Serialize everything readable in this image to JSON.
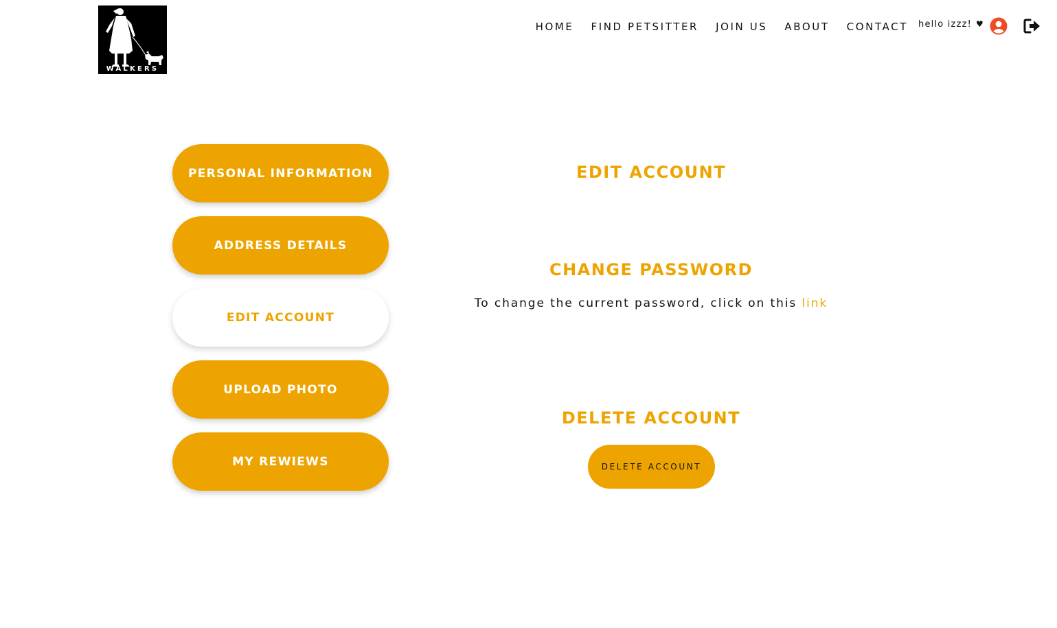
{
  "brand": {
    "logo_text": "WALKERS"
  },
  "nav": {
    "items": [
      {
        "label": "HOME"
      },
      {
        "label": "FIND PETSITTER"
      },
      {
        "label": "JOIN US"
      },
      {
        "label": "ABOUT"
      },
      {
        "label": "CONTACT"
      }
    ]
  },
  "user": {
    "greeting": "hello izzz!",
    "heart": "♥",
    "profile_icon": "user-circle-icon",
    "logout_icon": "sign-out-icon"
  },
  "sidebar": {
    "items": [
      {
        "label": "PERSONAL INFORMATION"
      },
      {
        "label": "ADDRESS DETAILS"
      },
      {
        "label": "EDIT ACCOUNT",
        "active": true
      },
      {
        "label": "UPLOAD PHOTO"
      },
      {
        "label": "MY REWIEWS"
      }
    ]
  },
  "main": {
    "title": "EDIT ACCOUNT",
    "change_password": {
      "heading": "CHANGE PASSWORD",
      "text": "To change the current password, click on this",
      "link_label": "link"
    },
    "delete_account": {
      "heading": "DELETE ACCOUNT",
      "button_label": "DELETE ACCOUNT"
    }
  },
  "colors": {
    "accent": "#eea400",
    "text": "#111111",
    "user_icon": "#f04a23",
    "background": "#ffffff"
  }
}
